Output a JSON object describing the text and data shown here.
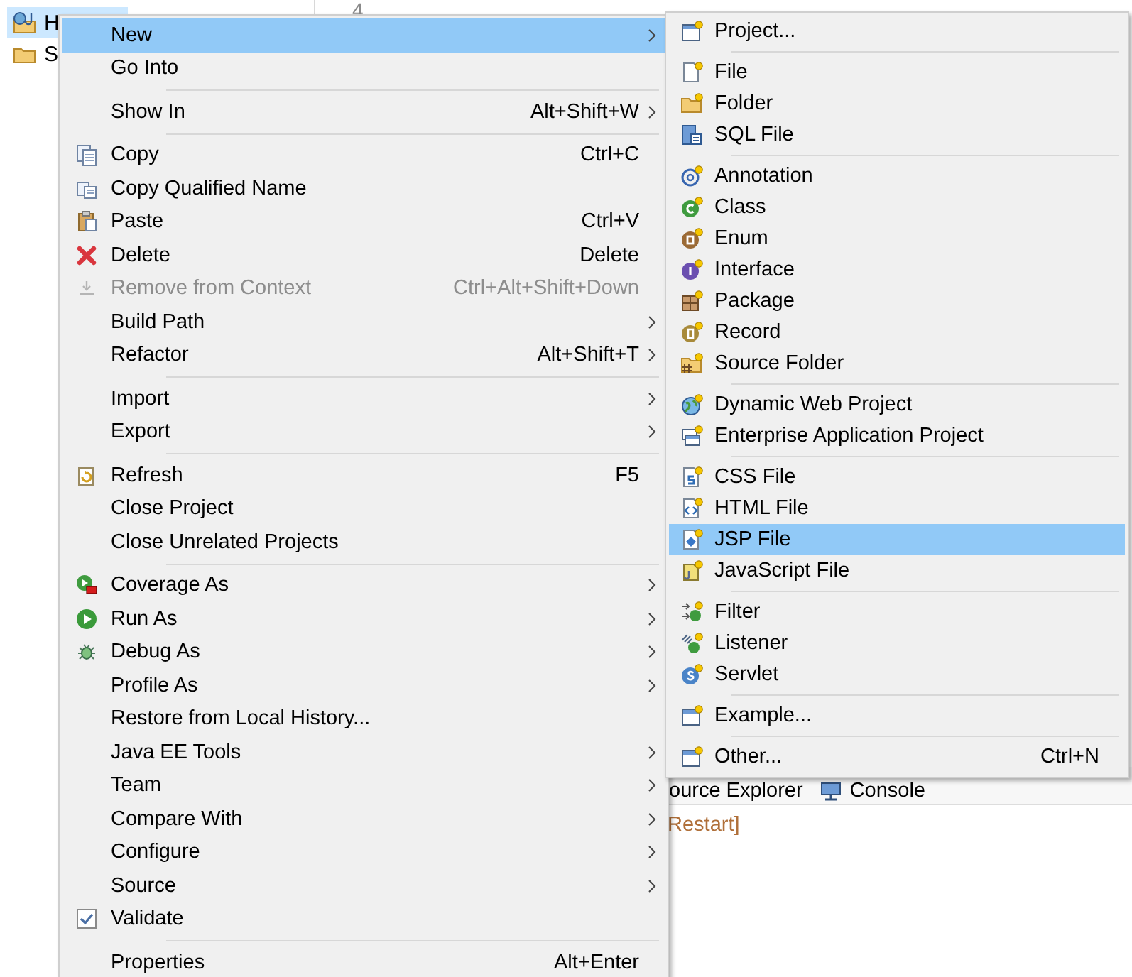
{
  "explorer": {
    "items": [
      {
        "label": "H",
        "selected": true
      },
      {
        "label": "S",
        "selected": false
      }
    ]
  },
  "editor": {
    "line_number": "4"
  },
  "context_menu": {
    "groups": [
      [
        {
          "label": "New",
          "has_submenu": true,
          "disabled": false,
          "selected": true
        },
        {
          "label": "Go Into",
          "has_submenu": false,
          "disabled": false,
          "selected": false
        }
      ],
      [
        {
          "label": "Show In",
          "shortcut": "Alt+Shift+W",
          "has_submenu": true,
          "disabled": false,
          "selected": false
        }
      ],
      [
        {
          "label": "Copy",
          "shortcut": "Ctrl+C",
          "has_submenu": false,
          "disabled": false,
          "selected": false
        },
        {
          "label": "Copy Qualified Name",
          "has_submenu": false,
          "disabled": false,
          "selected": false
        },
        {
          "label": "Paste",
          "shortcut": "Ctrl+V",
          "has_submenu": false,
          "disabled": false,
          "selected": false
        },
        {
          "label": "Delete",
          "shortcut": "Delete",
          "has_submenu": false,
          "disabled": false,
          "selected": false
        },
        {
          "label": "Remove from Context",
          "shortcut": "Ctrl+Alt+Shift+Down",
          "has_submenu": false,
          "disabled": true,
          "selected": false
        },
        {
          "label": "Build Path",
          "has_submenu": true,
          "disabled": false,
          "selected": false
        },
        {
          "label": "Refactor",
          "shortcut": "Alt+Shift+T",
          "has_submenu": true,
          "disabled": false,
          "selected": false
        }
      ],
      [
        {
          "label": "Import",
          "has_submenu": true,
          "disabled": false,
          "selected": false
        },
        {
          "label": "Export",
          "has_submenu": true,
          "disabled": false,
          "selected": false
        }
      ],
      [
        {
          "label": "Refresh",
          "shortcut": "F5",
          "has_submenu": false,
          "disabled": false,
          "selected": false
        },
        {
          "label": "Close Project",
          "has_submenu": false,
          "disabled": false,
          "selected": false
        },
        {
          "label": "Close Unrelated Projects",
          "has_submenu": false,
          "disabled": false,
          "selected": false
        }
      ],
      [
        {
          "label": "Coverage As",
          "has_submenu": true,
          "disabled": false,
          "selected": false
        },
        {
          "label": "Run As",
          "has_submenu": true,
          "disabled": false,
          "selected": false
        },
        {
          "label": "Debug As",
          "has_submenu": true,
          "disabled": false,
          "selected": false
        },
        {
          "label": "Profile As",
          "has_submenu": true,
          "disabled": false,
          "selected": false
        },
        {
          "label": "Restore from Local History...",
          "has_submenu": false,
          "disabled": false,
          "selected": false
        },
        {
          "label": "Java EE Tools",
          "has_submenu": true,
          "disabled": false,
          "selected": false
        },
        {
          "label": "Team",
          "has_submenu": true,
          "disabled": false,
          "selected": false
        },
        {
          "label": "Compare With",
          "has_submenu": true,
          "disabled": false,
          "selected": false
        },
        {
          "label": "Configure",
          "has_submenu": true,
          "disabled": false,
          "selected": false
        },
        {
          "label": "Source",
          "has_submenu": true,
          "disabled": false,
          "selected": false
        },
        {
          "label": "Validate",
          "has_submenu": false,
          "disabled": false,
          "selected": false,
          "checked": true
        }
      ],
      [
        {
          "label": "Properties",
          "shortcut": "Alt+Enter",
          "has_submenu": false,
          "disabled": false,
          "selected": false
        }
      ]
    ]
  },
  "new_submenu": {
    "groups": [
      [
        {
          "label": "Project...",
          "disabled": false,
          "selected": false
        }
      ],
      [
        {
          "label": "File",
          "disabled": false,
          "selected": false
        },
        {
          "label": "Folder",
          "disabled": false,
          "selected": false
        },
        {
          "label": "SQL File",
          "disabled": false,
          "selected": false
        }
      ],
      [
        {
          "label": "Annotation",
          "disabled": false,
          "selected": false
        },
        {
          "label": "Class",
          "disabled": false,
          "selected": false
        },
        {
          "label": "Enum",
          "disabled": false,
          "selected": false
        },
        {
          "label": "Interface",
          "disabled": false,
          "selected": false
        },
        {
          "label": "Package",
          "disabled": false,
          "selected": false
        },
        {
          "label": "Record",
          "disabled": false,
          "selected": false
        },
        {
          "label": "Source Folder",
          "disabled": false,
          "selected": false
        }
      ],
      [
        {
          "label": "Dynamic Web Project",
          "disabled": false,
          "selected": false
        },
        {
          "label": "Enterprise Application Project",
          "disabled": false,
          "selected": false
        }
      ],
      [
        {
          "label": "CSS File",
          "disabled": false,
          "selected": false
        },
        {
          "label": "HTML File",
          "disabled": false,
          "selected": false
        },
        {
          "label": "JSP File",
          "disabled": false,
          "selected": true
        },
        {
          "label": "JavaScript File",
          "disabled": false,
          "selected": false
        }
      ],
      [
        {
          "label": "Filter",
          "disabled": false,
          "selected": false
        },
        {
          "label": "Listener",
          "disabled": false,
          "selected": false
        },
        {
          "label": "Servlet",
          "disabled": false,
          "selected": false
        }
      ],
      [
        {
          "label": "Example...",
          "disabled": false,
          "selected": false
        }
      ],
      [
        {
          "label": "Other...",
          "shortcut": "Ctrl+N",
          "disabled": false,
          "selected": false
        }
      ]
    ]
  },
  "bottom_panel": {
    "tabs": [
      {
        "label": "ource Explorer"
      },
      {
        "label": "Console"
      }
    ],
    "console_text": "Restart]"
  }
}
